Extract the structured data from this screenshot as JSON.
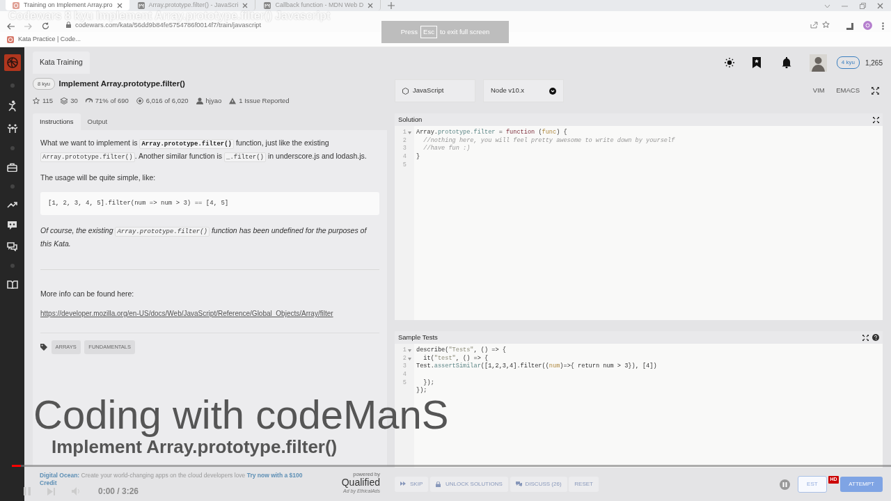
{
  "video_title": "Codewars 8 kyu Implement Array.prototype.filter() Javascript",
  "browser": {
    "tabs": [
      {
        "title": "Training on Implement Array.pro",
        "selected": true
      },
      {
        "title": "Array.prototype.filter() - JavaScri",
        "selected": false
      },
      {
        "title": "Callback function - MDN Web D",
        "selected": false
      }
    ],
    "url": "codewars.com/kata/56dd9b84fe5754786f0014f7/train/javascript",
    "bookmarks": [
      "Kata Practice | Code..."
    ]
  },
  "fullscreen_hint": {
    "before": "Press",
    "key": "Esc",
    "after": "to exit full screen"
  },
  "user": {
    "rank": "4 kyu",
    "honor": "1,265"
  },
  "kata": {
    "section_tab": "Kata Training",
    "rank": "8 kyu",
    "title": "Implement Array.prototype.filter()",
    "stats": [
      {
        "kind": "star",
        "text": "115"
      },
      {
        "kind": "collection",
        "text": "30"
      },
      {
        "kind": "satisfaction",
        "text": "71% of 690"
      },
      {
        "kind": "completed",
        "text": "6,016 of 6,020"
      },
      {
        "kind": "author",
        "text": "hjyao"
      },
      {
        "kind": "issue",
        "text": "1 Issue Reported"
      }
    ],
    "tabs": [
      {
        "label": "Instructions",
        "selected": true
      },
      {
        "label": "Output",
        "selected": false
      }
    ],
    "description": [
      {
        "kind": "paragraph",
        "italic": false,
        "parts": [
          {
            "kind": "text",
            "text": "What we want to implement is "
          },
          {
            "kind": "strong_code",
            "text": "Array.prototype.filter()"
          },
          {
            "kind": "text",
            "text": " function, just like the existing "
          },
          {
            "kind": "code",
            "text": "Array.prototype.filter()"
          },
          {
            "kind": "text",
            "text": ". Another similar function is "
          },
          {
            "kind": "code",
            "text": "_.filter()"
          },
          {
            "kind": "text",
            "text": " in underscore.js and lodash.js."
          }
        ]
      },
      {
        "kind": "paragraph",
        "italic": false,
        "parts": [
          {
            "kind": "text",
            "text": "The usage will be quite simple, like:"
          }
        ]
      },
      {
        "kind": "code_block",
        "text": "[1, 2, 3, 4, 5].filter(num => num > 3) == [4, 5]"
      },
      {
        "kind": "paragraph",
        "italic": true,
        "parts": [
          {
            "kind": "text",
            "text": "Of course, the existing "
          },
          {
            "kind": "code",
            "text": "Array.prototype.filter()"
          },
          {
            "kind": "text",
            "text": " function has been undefined for the purposes of this Kata."
          }
        ]
      },
      {
        "kind": "rule"
      },
      {
        "kind": "paragraph",
        "italic": false,
        "parts": [
          {
            "kind": "text",
            "text": "More info can be found here:"
          }
        ]
      },
      {
        "kind": "link",
        "text": "https://developer.mozilla.org/en-US/docs/Web/JavaScript/Reference/Global_Objects/Array/filter"
      }
    ],
    "tags": [
      "ARRAYS",
      "FUNDAMENTALS"
    ]
  },
  "ad": {
    "sponsor": "Digital Ocean:",
    "text": "Create your world-changing apps on the cloud developers love",
    "cta": "Try now with a $100 Credit",
    "credit": "Ad by EthicalAds",
    "powered_by": "powered by",
    "brand": "Qualified"
  },
  "editor": {
    "language": "JavaScript",
    "version": "Node v10.x",
    "modes": [
      "VIM",
      "EMACS"
    ],
    "solution": {
      "title": "Solution",
      "lines": [
        {
          "number": "1",
          "fold": true,
          "tokens": [
            {
              "kind": "plain",
              "text": "Array."
            },
            {
              "kind": "prop",
              "text": "prototype.filter"
            },
            {
              "kind": "plain",
              "text": " = "
            },
            {
              "kind": "keyword",
              "text": "function"
            },
            {
              "kind": "plain",
              "text": " ("
            },
            {
              "kind": "param",
              "text": "func"
            },
            {
              "kind": "plain",
              "text": ") {"
            }
          ]
        },
        {
          "number": "2",
          "fold": false,
          "tokens": [
            {
              "kind": "comment",
              "text": "  //nothing here, you will feel pretty awesome to write down by yourself"
            }
          ]
        },
        {
          "number": "3",
          "fold": false,
          "tokens": [
            {
              "kind": "comment",
              "text": "  //have fun :)"
            }
          ]
        },
        {
          "number": "4",
          "fold": false,
          "tokens": [
            {
              "kind": "plain",
              "text": "}"
            }
          ]
        },
        {
          "number": "5",
          "fold": false
        }
      ]
    },
    "tests": {
      "title": "Sample Tests",
      "lines": [
        {
          "number": "1",
          "fold": true,
          "tokens": [
            {
              "kind": "plain",
              "text": "describe("
            },
            {
              "kind": "string",
              "text": "\"Tests\""
            },
            {
              "kind": "plain",
              "text": ", () => {"
            }
          ]
        },
        {
          "number": "2",
          "fold": true,
          "tokens": [
            {
              "kind": "plain",
              "text": "  it("
            },
            {
              "kind": "string",
              "text": "\"test\""
            },
            {
              "kind": "plain",
              "text": ", () => {"
            }
          ]
        },
        {
          "number": "3",
          "fold": false,
          "tokens": [
            {
              "kind": "plain",
              "text": "Test."
            },
            {
              "kind": "prop",
              "text": "assertSimilar"
            },
            {
              "kind": "plain",
              "text": "([1,2,3,4].filter(("
            },
            {
              "kind": "param",
              "text": "num"
            },
            {
              "kind": "plain",
              "text": ")=>{ return num > 3}), [4])"
            }
          ]
        },
        {
          "number": "4",
          "fold": false
        },
        {
          "number": "5",
          "fold": false,
          "tokens": [
            {
              "kind": "plain",
              "text": "  });"
            }
          ]
        },
        {
          "fold": false,
          "tokens": [
            {
              "kind": "plain",
              "text": "});"
            }
          ]
        }
      ]
    },
    "actions": [
      {
        "kind": "skip",
        "label": "SKIP"
      },
      {
        "kind": "unlock",
        "label": "UNLOCK SOLUTIONS"
      },
      {
        "kind": "discuss",
        "label": "DISCUSS (26)"
      },
      {
        "kind": "reset",
        "label": "RESET"
      }
    ],
    "submit": [
      {
        "kind": "test",
        "label": "EST"
      },
      {
        "kind": "attempt",
        "label": "ATTEMPT"
      }
    ]
  },
  "overlay": {
    "title": "Coding with codeManS",
    "subtitle": "Implement Array.prototype.filter()"
  },
  "player": {
    "level": 0.01,
    "time": "0:00 / 3:26",
    "quality": "HD"
  }
}
